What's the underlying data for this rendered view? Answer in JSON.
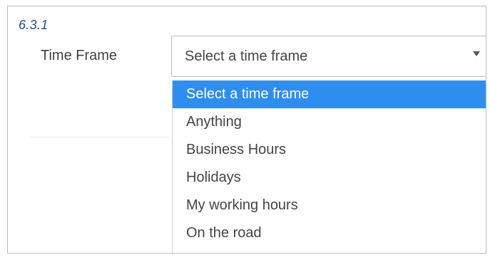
{
  "version_tag": "6.3.1",
  "time_frame": {
    "label": "Time Frame",
    "selected_value": "Select a time frame",
    "arrow_icon": "caret-down-icon",
    "options": [
      {
        "label": "Select a time frame",
        "highlighted": true
      },
      {
        "label": "Anything",
        "highlighted": false
      },
      {
        "label": "Business Hours",
        "highlighted": false
      },
      {
        "label": "Holidays",
        "highlighted": false
      },
      {
        "label": "My working hours",
        "highlighted": false
      },
      {
        "label": "On the road",
        "highlighted": false
      }
    ]
  },
  "colors": {
    "highlight": "#2e8ef0",
    "version_tag": "#1f4e8c"
  }
}
